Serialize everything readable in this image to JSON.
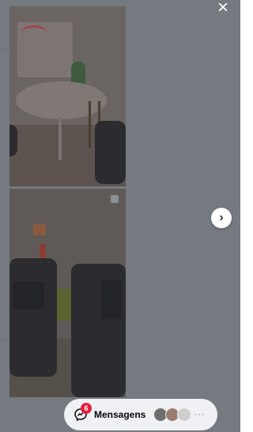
{
  "viewer": {
    "close_symbol": "×",
    "next_symbol": "›"
  },
  "messages": {
    "label": "Mensagens",
    "badge_count": "6",
    "more_symbol": "···",
    "avatar_colors": [
      "#6e6e6e",
      "#9a7d6d",
      "#cfcfcf"
    ]
  },
  "colors": {
    "overlay": "#4e545c",
    "badge": "#e41e3f",
    "pill_bg": "#eff1f4"
  }
}
